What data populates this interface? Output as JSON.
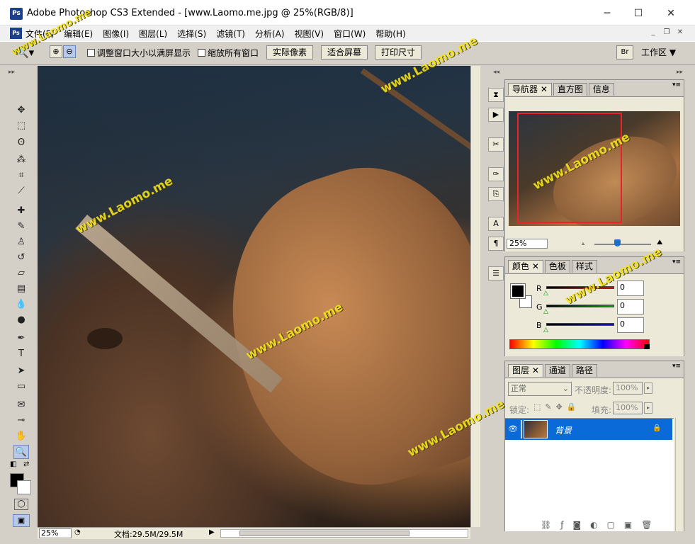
{
  "window": {
    "app_icon": "Ps",
    "title": "Adobe Photoshop CS3 Extended - [www.Laomo.me.jpg @ 25%(RGB/8)]",
    "minimize": "─",
    "maximize": "☐",
    "close": "✕"
  },
  "menu": {
    "icon": "Ps",
    "items": [
      "文件(F)",
      "编辑(E)",
      "图像(I)",
      "图层(L)",
      "选择(S)",
      "滤镜(T)",
      "分析(A)",
      "视图(V)",
      "窗口(W)",
      "帮助(H)"
    ],
    "doc_minimize": "_",
    "doc_restore": "❐",
    "doc_close": "✕"
  },
  "options": {
    "resize_windows": "调整窗口大小以满屏显示",
    "zoom_all_windows": "缩放所有窗口",
    "actual_pixels": "实际像素",
    "fit_screen": "适合屏幕",
    "print_size": "打印尺寸",
    "workspace": "工作区 ▼"
  },
  "toolbar": {
    "logo": "Ps",
    "tools": [
      {
        "name": "move-tool-icon",
        "glyph": "✥"
      },
      {
        "name": "marquee-tool-icon",
        "glyph": "⬚"
      },
      {
        "name": "lasso-tool-icon",
        "glyph": "ʘ"
      },
      {
        "name": "magic-wand-tool-icon",
        "glyph": "⁂"
      },
      {
        "name": "crop-tool-icon",
        "glyph": "⌗"
      },
      {
        "name": "slice-tool-icon",
        "glyph": "⟋"
      },
      {
        "name": "healing-brush-tool-icon",
        "glyph": "✚"
      },
      {
        "name": "brush-tool-icon",
        "glyph": "✎"
      },
      {
        "name": "clone-stamp-tool-icon",
        "glyph": "♙"
      },
      {
        "name": "history-brush-tool-icon",
        "glyph": "↺"
      },
      {
        "name": "eraser-tool-icon",
        "glyph": "▱"
      },
      {
        "name": "gradient-tool-icon",
        "glyph": "▤"
      },
      {
        "name": "blur-tool-icon",
        "glyph": "💧"
      },
      {
        "name": "dodge-tool-icon",
        "glyph": "●"
      },
      {
        "name": "pen-tool-icon",
        "glyph": "✒"
      },
      {
        "name": "type-tool-icon",
        "glyph": "T"
      },
      {
        "name": "path-selection-tool-icon",
        "glyph": "➤"
      },
      {
        "name": "rectangle-tool-icon",
        "glyph": "▭"
      },
      {
        "name": "notes-tool-icon",
        "glyph": "✉"
      },
      {
        "name": "eyedropper-tool-icon",
        "glyph": "⊸"
      },
      {
        "name": "hand-tool-icon",
        "glyph": "✋"
      },
      {
        "name": "zoom-tool-icon",
        "glyph": "🔍"
      }
    ]
  },
  "status": {
    "zoom": "25%",
    "doc_size": "文档:29.5M/29.5M"
  },
  "navigator": {
    "tabs": [
      "导航器",
      "直方图",
      "信息"
    ],
    "zoom": "25%"
  },
  "color_panel": {
    "tabs": [
      "颜色",
      "色板",
      "样式"
    ],
    "channels": [
      {
        "label": "R",
        "value": "0",
        "color": "#cc1010"
      },
      {
        "label": "G",
        "value": "0",
        "color": "#10a010"
      },
      {
        "label": "B",
        "value": "0",
        "color": "#1010cc"
      }
    ]
  },
  "layers_panel": {
    "tabs": [
      "图层",
      "通道",
      "路径"
    ],
    "blend_mode": "正常",
    "opacity_label": "不透明度:",
    "opacity_value": "100%",
    "lock_label": "锁定:",
    "fill_label": "填充:",
    "fill_value": "100%",
    "layer_name": "背景"
  },
  "watermark": "www.Laomo.me"
}
